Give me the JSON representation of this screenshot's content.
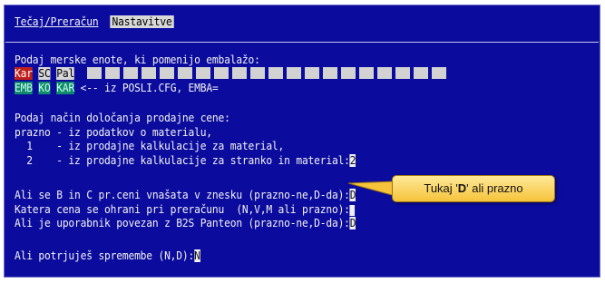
{
  "menu": {
    "item1": "Tečaj/Preračun",
    "item2": "Nastavitve"
  },
  "units": {
    "prompt": "Podaj merske enote, ki pomenijo embalažo:",
    "row1": [
      "Kar",
      "SC",
      "Pal"
    ],
    "row2": [
      "EMB",
      "KO",
      "KAR"
    ],
    "row2_note": "<-- iz POSLI.CFG, EMBA="
  },
  "pricing": {
    "prompt": "Podaj način določanja prodajne cene:",
    "opt0": "prazno - iz podatkov o materialu,",
    "opt1": "  1    - iz prodajne kalkulacije za material,",
    "opt2": "  2    - iz prodajne kalkulacije za stranko in material:",
    "opt2_value": "2"
  },
  "questions": {
    "q1": "Ali se B in C pr.ceni vnašata v znesku (prazno-ne,D-da):",
    "q1_value": "D",
    "q2": "Katera cena se ohrani pri preračunu  (N,V,M ali prazno):",
    "q2_value": "",
    "q3": "Ali je uporabnik povezan z B2S Panteon (prazno-ne,D-da):",
    "q3_value": "D"
  },
  "confirm": {
    "prompt": "Ali potrjuješ spremembe (N,D):",
    "value": "N"
  },
  "callout": {
    "pre": "Tukaj '",
    "bold": "D",
    "post": "' ali prazno"
  },
  "colors": {
    "terminal_bg": "#0b0b9e",
    "text": "#f2f2f2",
    "selected_unit": "#c0201a",
    "unit_tag_bg": "#0f8a6c",
    "callout_bg": "#f6c33a"
  }
}
